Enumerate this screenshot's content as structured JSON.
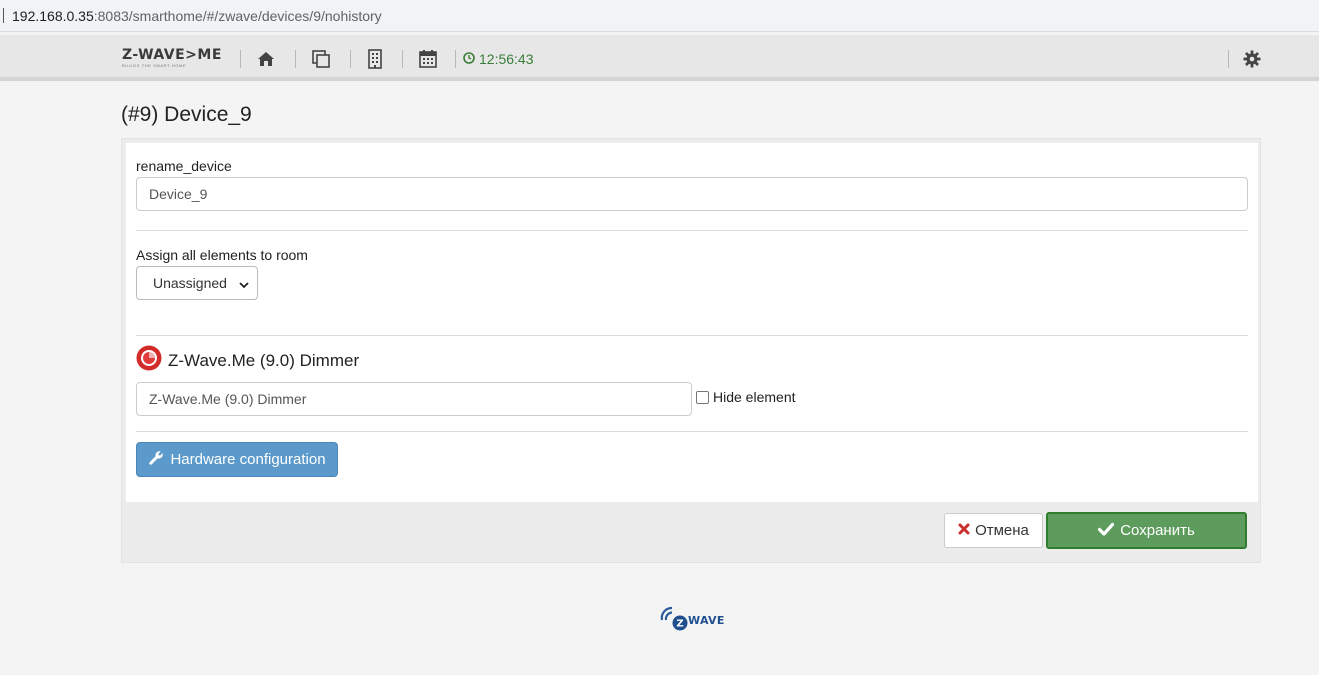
{
  "browser": {
    "url_host": "192.168.0.35",
    "url_rest": ":8083/smarthome/#/zwave/devices/9/nohistory"
  },
  "navbar": {
    "logo_text": "Z-WAVE>ME",
    "logo_tagline": "BUILDS THE SMART HOME",
    "icons": [
      "home-icon",
      "copy-icon",
      "building-icon",
      "calendar-icon",
      "gear-icon"
    ],
    "clock": "12:56:43",
    "clock_color": "#3a7d3a"
  },
  "page": {
    "title": "(#9) Device_9"
  },
  "form": {
    "rename_label": "rename_device",
    "rename_value": "Device_9",
    "room_label": "Assign all elements to room",
    "room_selected": "Unassigned",
    "element_title": "Z-Wave.Me (9.0) Dimmer",
    "element_value": "Z-Wave.Me (9.0) Dimmer",
    "hide_label": "Hide element",
    "hardware_button": "Hardware configuration"
  },
  "actions": {
    "cancel_label": "Отмена",
    "save_label": "Сохранить"
  },
  "footer": {
    "logo_text": "ZWAVE"
  },
  "colors": {
    "primary": "#5b9acb",
    "success": "#5e9c5e",
    "danger": "#c9302c"
  }
}
